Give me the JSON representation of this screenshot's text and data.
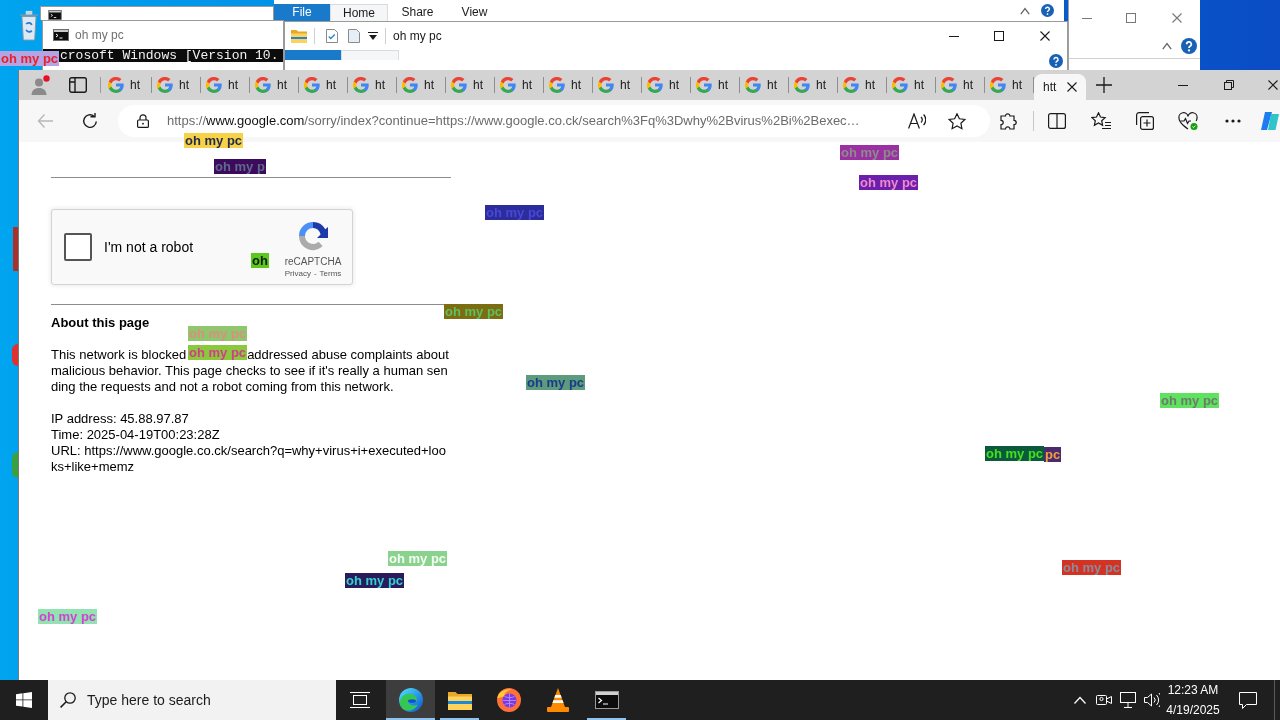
{
  "explorer_back": {
    "file_tab": "File",
    "ribbon_tabs": [
      {
        "label": "Home",
        "selected": true
      },
      {
        "label": "Share",
        "selected": false
      },
      {
        "label": "View",
        "selected": false
      }
    ]
  },
  "cmd_window": {
    "title": "oh my pc",
    "output": "crosoft Windows [Version 10."
  },
  "explorer_window": {
    "title": "oh my pc"
  },
  "browser": {
    "tabs": [
      {
        "title": "ht",
        "selected": false
      },
      {
        "title": "ht",
        "selected": false
      },
      {
        "title": "ht",
        "selected": false
      },
      {
        "title": "ht",
        "selected": false
      },
      {
        "title": "ht",
        "selected": false
      },
      {
        "title": "ht",
        "selected": false
      },
      {
        "title": "ht",
        "selected": false
      },
      {
        "title": "ht",
        "selected": false
      },
      {
        "title": "ht",
        "selected": false
      },
      {
        "title": "ht",
        "selected": false
      },
      {
        "title": "ht",
        "selected": false
      },
      {
        "title": "ht",
        "selected": false
      },
      {
        "title": "ht",
        "selected": false
      },
      {
        "title": "ht",
        "selected": false
      },
      {
        "title": "ht",
        "selected": false
      },
      {
        "title": "ht",
        "selected": false
      },
      {
        "title": "ht",
        "selected": false
      },
      {
        "title": "ht",
        "selected": false
      },
      {
        "title": "ht",
        "selected": false
      },
      {
        "title": "htt",
        "selected": true
      }
    ],
    "back_button": {
      "disabled": true
    },
    "address": {
      "scheme": "https://",
      "host": "www.google.com",
      "path": "/sorry/index?continue=https://www.google.co.ck/search%3Fq%3Dwhy%2Bvirus%2Bi%2Bexec…"
    },
    "page": {
      "captcha": {
        "label": "I'm not a robot",
        "checked": false,
        "brand": "reCAPTCHA",
        "privacy": "Privacy",
        "separator": "-",
        "terms": "Terms"
      },
      "heading": "About this page",
      "paragraph_start": "This network is blocked",
      "paragraph_after": "addressed abuse complaints about",
      "paragraph_rest": "malicious behavior. This page checks to see if it's really a human sending the requests and not a robot coming from this network.",
      "details": [
        "IP address: 45.88.97.87",
        "Time: 2025-04-19T00:23:28Z",
        "URL: https://www.google.co.ck/search?q=why+virus+i+executed+looks+like+memz"
      ]
    }
  },
  "overlay_labels": [
    {
      "text": "oh my pc",
      "color": "#b4a4e4"
    },
    {
      "text": "oh my pc",
      "color": "#f7d246"
    },
    {
      "text": "oh my pc",
      "color": "#9b30a2"
    },
    {
      "text": "oh my p",
      "color": "#3d0b5c"
    },
    {
      "text": "oh my pc",
      "color": "#6b20ac"
    },
    {
      "text": "oh my pc",
      "color": "#2c2c9a"
    },
    {
      "text": "oh",
      "color": "#5cc81e"
    },
    {
      "text": "oh my pc",
      "color": "#7c6c12"
    },
    {
      "text": "oh my pc",
      "color": "#8fc66e"
    },
    {
      "text": "oh my pc",
      "color": "#8cc83c"
    },
    {
      "text": "oh my pc",
      "color": "#5c9b7c"
    },
    {
      "text": "oh my pc",
      "color": "#5fe25f"
    },
    {
      "text": "pc",
      "color": "#4b2b6b"
    },
    {
      "text": "oh my pc",
      "color": "#0c5a3c"
    },
    {
      "text": "oh my pc",
      "color": "#8ad28e"
    },
    {
      "text": "oh my pc",
      "color": "#d43222"
    },
    {
      "text": "oh my pc",
      "color": "#2a1b5c"
    },
    {
      "text": "oh my pc",
      "color": "#92e2b2"
    }
  ],
  "taskbar": {
    "search_placeholder": "Type here to search",
    "apps": [
      {
        "kind": "edge",
        "running": true,
        "selected": true
      },
      {
        "kind": "explorer",
        "running": true,
        "selected": false
      },
      {
        "kind": "firefox",
        "running": false,
        "selected": false
      },
      {
        "kind": "vlc",
        "running": false,
        "selected": false
      },
      {
        "kind": "terminal",
        "running": true,
        "selected": false
      }
    ],
    "time": "12:23 AM",
    "date": "4/19/2025"
  }
}
